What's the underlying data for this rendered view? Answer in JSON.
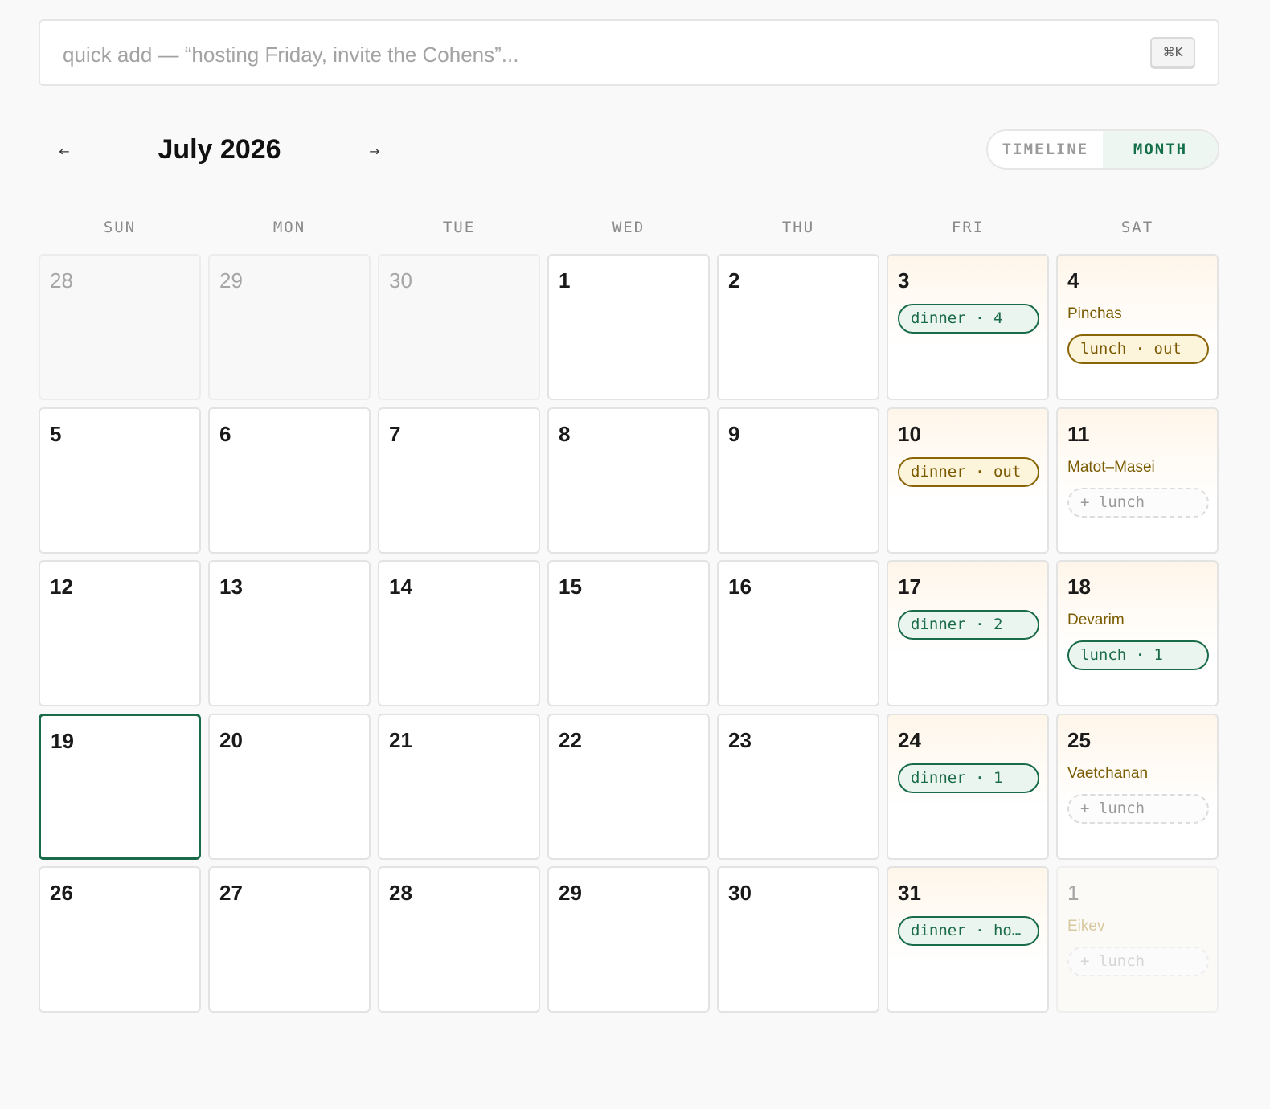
{
  "quick_add": {
    "placeholder": "quick add — “hosting Friday, invite the Cohens”...",
    "shortcut": "⌘K"
  },
  "header": {
    "prev_icon": "←",
    "next_icon": "→",
    "title": "July 2026",
    "views": [
      "TIMELINE",
      "MONTH"
    ],
    "active_view": "MONTH"
  },
  "weekdays": [
    "SUN",
    "MON",
    "TUE",
    "WED",
    "THU",
    "FRI",
    "SAT"
  ],
  "colors": {
    "accent_green": "#1a6b4a",
    "amber": "#8a6508",
    "weekend_tint": "#fff6ea"
  },
  "days": [
    {
      "num": "28",
      "state": "outside"
    },
    {
      "num": "29",
      "state": "outside"
    },
    {
      "num": "30",
      "state": "outside"
    },
    {
      "num": "1"
    },
    {
      "num": "2"
    },
    {
      "num": "3",
      "weekend": true,
      "meals": [
        {
          "label": "dinner · 4",
          "style": "green"
        }
      ]
    },
    {
      "num": "4",
      "weekend": true,
      "parsha": "Pinchas",
      "meals": [
        {
          "label": "lunch · out",
          "style": "amber"
        }
      ]
    },
    {
      "num": "5"
    },
    {
      "num": "6"
    },
    {
      "num": "7"
    },
    {
      "num": "8"
    },
    {
      "num": "9"
    },
    {
      "num": "10",
      "weekend": true,
      "meals": [
        {
          "label": "dinner · out",
          "style": "amber"
        }
      ]
    },
    {
      "num": "11",
      "weekend": true,
      "parsha": "Matot–Masei",
      "meals": [
        {
          "label": "+ lunch",
          "style": "dashed"
        }
      ]
    },
    {
      "num": "12"
    },
    {
      "num": "13"
    },
    {
      "num": "14"
    },
    {
      "num": "15"
    },
    {
      "num": "16"
    },
    {
      "num": "17",
      "weekend": true,
      "meals": [
        {
          "label": "dinner · 2",
          "style": "green"
        }
      ]
    },
    {
      "num": "18",
      "weekend": true,
      "parsha": "Devarim",
      "meals": [
        {
          "label": "lunch · 1",
          "style": "green"
        }
      ]
    },
    {
      "num": "19",
      "today": true
    },
    {
      "num": "20"
    },
    {
      "num": "21"
    },
    {
      "num": "22"
    },
    {
      "num": "23"
    },
    {
      "num": "24",
      "weekend": true,
      "meals": [
        {
          "label": "dinner · 1",
          "style": "green"
        }
      ]
    },
    {
      "num": "25",
      "weekend": true,
      "parsha": "Vaetchanan",
      "meals": [
        {
          "label": "+ lunch",
          "style": "dashed"
        }
      ]
    },
    {
      "num": "26"
    },
    {
      "num": "27"
    },
    {
      "num": "28"
    },
    {
      "num": "29"
    },
    {
      "num": "30"
    },
    {
      "num": "31",
      "weekend": true,
      "meals": [
        {
          "label": "dinner · ho…",
          "style": "green"
        }
      ]
    },
    {
      "num": "1",
      "weekend": true,
      "state": "outside",
      "parsha": "Eikev",
      "meals": [
        {
          "label": "+ lunch",
          "style": "dashed"
        }
      ]
    }
  ]
}
